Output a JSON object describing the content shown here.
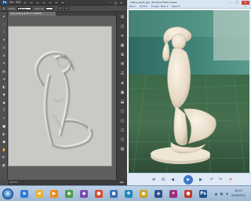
{
  "photoshop": {
    "logo": "Ps",
    "menus": [
      "File",
      "Edit",
      "Image",
      "Layer",
      "Select",
      "Filter",
      "Analysis",
      "3D",
      "View",
      "Window",
      "Help"
    ],
    "options_bar": {
      "label": "Mode:",
      "field_value": "Normal",
      "second_label": "Opacity:"
    },
    "doc_tab": "slab_edit.jpg @ 66.7% (RGB/8)",
    "status": "66.67%",
    "status_nav": "◀ ▶",
    "tools": [
      "▸",
      "⬚",
      "⌇",
      "⌖",
      "⊡",
      "⊘",
      "✎",
      "▤",
      "⟲",
      "◧",
      "▼",
      "◆",
      "T",
      "↖",
      "■",
      "◐",
      "⬢",
      "✋",
      "🔍",
      "◩"
    ],
    "dock": [
      "⊞",
      "◫",
      "≡",
      "▦",
      "⧉",
      "⌘",
      "☰",
      "◈",
      "▣",
      "⬓",
      "◰",
      "◱",
      "◲",
      "◳",
      "▧"
    ]
  },
  "photo_viewer": {
    "title": "statue_photo.jpg - Windows Photo Viewer",
    "menus": [
      "File ▾",
      "Print ▾",
      "E-mail",
      "Burn ▾",
      "Open ▾"
    ],
    "help": "?",
    "controls": [
      "⊕",
      "⊟",
      "⊗",
      "◀",
      "▶",
      "↶",
      "↷",
      "✕"
    ]
  },
  "taskbar": {
    "start_glyph": "⊞",
    "apps": [
      {
        "name": "ie",
        "glyph": "e",
        "color": "#2b7bd0"
      },
      {
        "name": "explorer",
        "glyph": "▰",
        "color": "#e7b339"
      },
      {
        "name": "media",
        "glyph": "▶",
        "color": "#f08a18"
      },
      {
        "name": "app4",
        "glyph": "◉",
        "color": "#4a9d48"
      },
      {
        "name": "app5",
        "glyph": "◆",
        "color": "#7a4ab2"
      },
      {
        "name": "app6",
        "glyph": "●",
        "color": "#d64a2b"
      },
      {
        "name": "app7",
        "glyph": "◼",
        "color": "#3b6fb6"
      },
      {
        "name": "app8",
        "glyph": "❖",
        "color": "#1e8bb8"
      },
      {
        "name": "app9",
        "glyph": "▣",
        "color": "#c7a122"
      },
      {
        "name": "app10",
        "glyph": "◈",
        "color": "#2c4f8f"
      },
      {
        "name": "app11",
        "glyph": "✦",
        "color": "#9a2f7c"
      },
      {
        "name": "app12",
        "glyph": "●",
        "color": "#c2392f"
      },
      {
        "name": "photoshop",
        "glyph": "Ps",
        "color": "#1d4f88"
      }
    ],
    "time": "08:25",
    "date": "02/08/2012"
  }
}
